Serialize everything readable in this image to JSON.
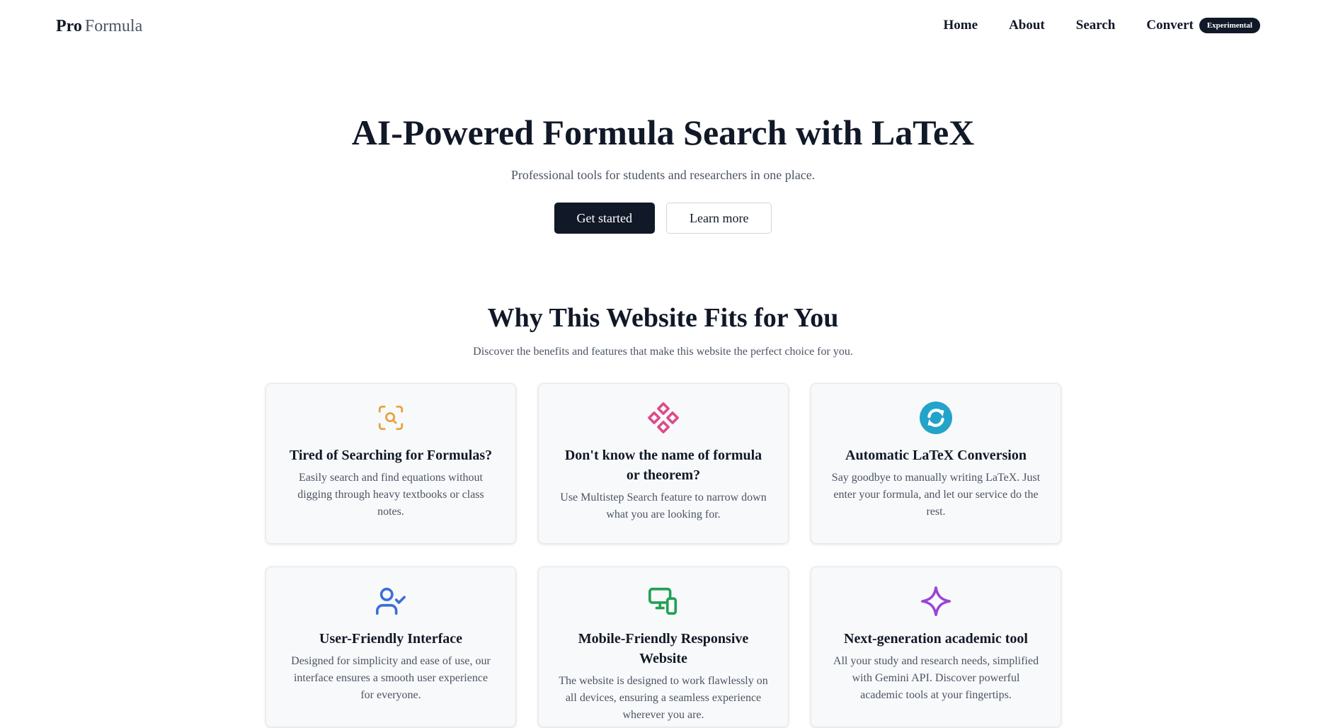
{
  "header": {
    "logo_bold": "Pro",
    "logo_light": "Formula",
    "nav": [
      "Home",
      "About",
      "Search",
      "Convert"
    ],
    "badge": "Experimental"
  },
  "hero": {
    "title": "AI-Powered Formula Search with LaTeX",
    "subtitle": "Professional tools for students and researchers in one place.",
    "primary_button": "Get started",
    "secondary_button": "Learn more"
  },
  "features": {
    "title": "Why This Website Fits for You",
    "subtitle": "Discover the benefits and features that make this website the perfect choice for you.",
    "cards": [
      {
        "icon": "scan-search-icon",
        "color": "#e8a33d",
        "title": "Tired of Searching for Formulas?",
        "text": "Easily search and find equations without digging through heavy textbooks or class notes."
      },
      {
        "icon": "diamonds-icon",
        "color": "#db4c8a",
        "title": "Don't know the name of formula or theorem?",
        "text": "Use Multistep Search feature to narrow down what you are looking for."
      },
      {
        "icon": "refresh-circle-icon",
        "color": "#22a3c9",
        "title": "Automatic LaTeX Conversion",
        "text": "Say goodbye to manually writing LaTeX. Just enter your formula, and let our service do the rest."
      },
      {
        "icon": "user-check-icon",
        "color": "#3b6fd8",
        "title": "User-Friendly Interface",
        "text": "Designed for simplicity and ease of use, our interface ensures a smooth user experience for everyone."
      },
      {
        "icon": "devices-icon",
        "color": "#22a154",
        "title": "Mobile-Friendly Responsive Website",
        "text": "The website is designed to work flawlessly on all devices, ensuring a seamless experience wherever you are."
      },
      {
        "icon": "sparkle-icon",
        "color": "#9a45d6",
        "title": "Next-generation academic tool",
        "text": "All your study and research needs, simplified with Gemini API. Discover powerful academic tools at your fingertips."
      }
    ]
  }
}
